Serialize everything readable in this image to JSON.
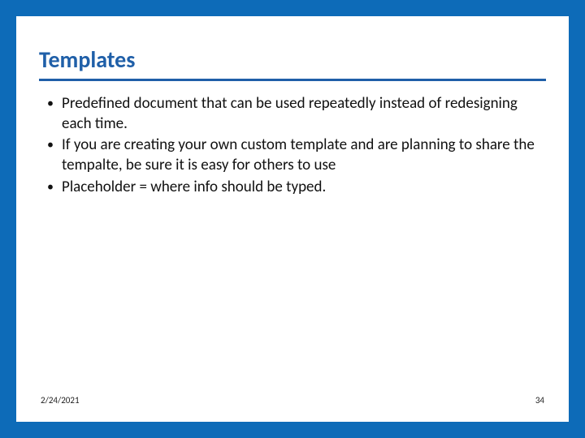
{
  "slide": {
    "title": "Templates",
    "bullets": [
      "Predefined document that can be used repeatedly instead of redesigning each time.",
      "If you are creating your own custom template and are planning to share the tempalte, be sure it is easy for others to use",
      "Placeholder = where info should be typed."
    ],
    "footer": {
      "date": "2/24/2021",
      "page": "34"
    }
  }
}
